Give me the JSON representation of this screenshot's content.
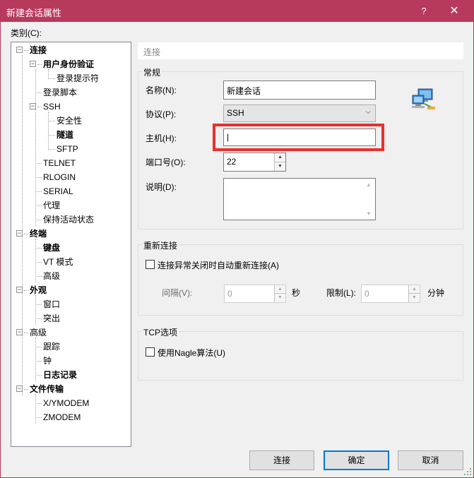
{
  "window": {
    "title": "新建会话属性",
    "help": "?",
    "close": "✕"
  },
  "category_label": "类别(C):",
  "tree": {
    "items": [
      {
        "label": "连接",
        "bold": true,
        "expander": "−"
      },
      {
        "label": "用户身份验证",
        "bold": true,
        "expander": "−"
      },
      {
        "label": "登录提示符",
        "bold": false
      },
      {
        "label": "登录脚本",
        "bold": false
      },
      {
        "label": "SSH",
        "bold": false,
        "expander": "−"
      },
      {
        "label": "安全性",
        "bold": false
      },
      {
        "label": "隧道",
        "bold": true
      },
      {
        "label": "SFTP",
        "bold": false
      },
      {
        "label": "TELNET",
        "bold": false
      },
      {
        "label": "RLOGIN",
        "bold": false
      },
      {
        "label": "SERIAL",
        "bold": false
      },
      {
        "label": "代理",
        "bold": false
      },
      {
        "label": "保持活动状态",
        "bold": false
      },
      {
        "label": "终端",
        "bold": true,
        "expander": "−"
      },
      {
        "label": "键盘",
        "bold": true
      },
      {
        "label": "VT 模式",
        "bold": false
      },
      {
        "label": "高级",
        "bold": false
      },
      {
        "label": "外观",
        "bold": true,
        "expander": "−"
      },
      {
        "label": "窗口",
        "bold": false
      },
      {
        "label": "突出",
        "bold": false
      },
      {
        "label": "高级",
        "bold": false,
        "expander": "−"
      },
      {
        "label": "跟踪",
        "bold": false
      },
      {
        "label": "钟",
        "bold": false
      },
      {
        "label": "日志记录",
        "bold": true
      },
      {
        "label": "文件传输",
        "bold": true,
        "expander": "−"
      },
      {
        "label": "X/YMODEM",
        "bold": false
      },
      {
        "label": "ZMODEM",
        "bold": false
      }
    ]
  },
  "breadcrumb": "连接",
  "general": {
    "group_title": "常规",
    "name_label": "名称(N):",
    "name_value": "新建会话",
    "protocol_label": "协议(P):",
    "protocol_value": "SSH",
    "host_label": "主机(H):",
    "host_value": "|",
    "port_label": "端口号(O):",
    "port_value": "22",
    "desc_label": "说明(D):"
  },
  "reconnect": {
    "group_title": "重新连接",
    "checkbox_label": "连接异常关闭时自动重新连接(A)",
    "interval_label": "间隔(V):",
    "interval_value": "0",
    "interval_unit": "秒",
    "limit_label": "限制(L):",
    "limit_value": "0",
    "limit_unit": "分钟"
  },
  "tcp": {
    "group_title": "TCP选项",
    "nagle_label": "使用Nagle算法(U)"
  },
  "buttons": {
    "connect": "连接",
    "ok": "确定",
    "cancel": "取消"
  },
  "icons": {
    "network": "network-computers-icon",
    "spin_up": "▲",
    "spin_down": "▼",
    "combo_arrow": "⌵"
  },
  "colors": {
    "titlebar": "#b73a5d",
    "highlight": "#e8302d",
    "default_button_border": "#0078d7"
  }
}
